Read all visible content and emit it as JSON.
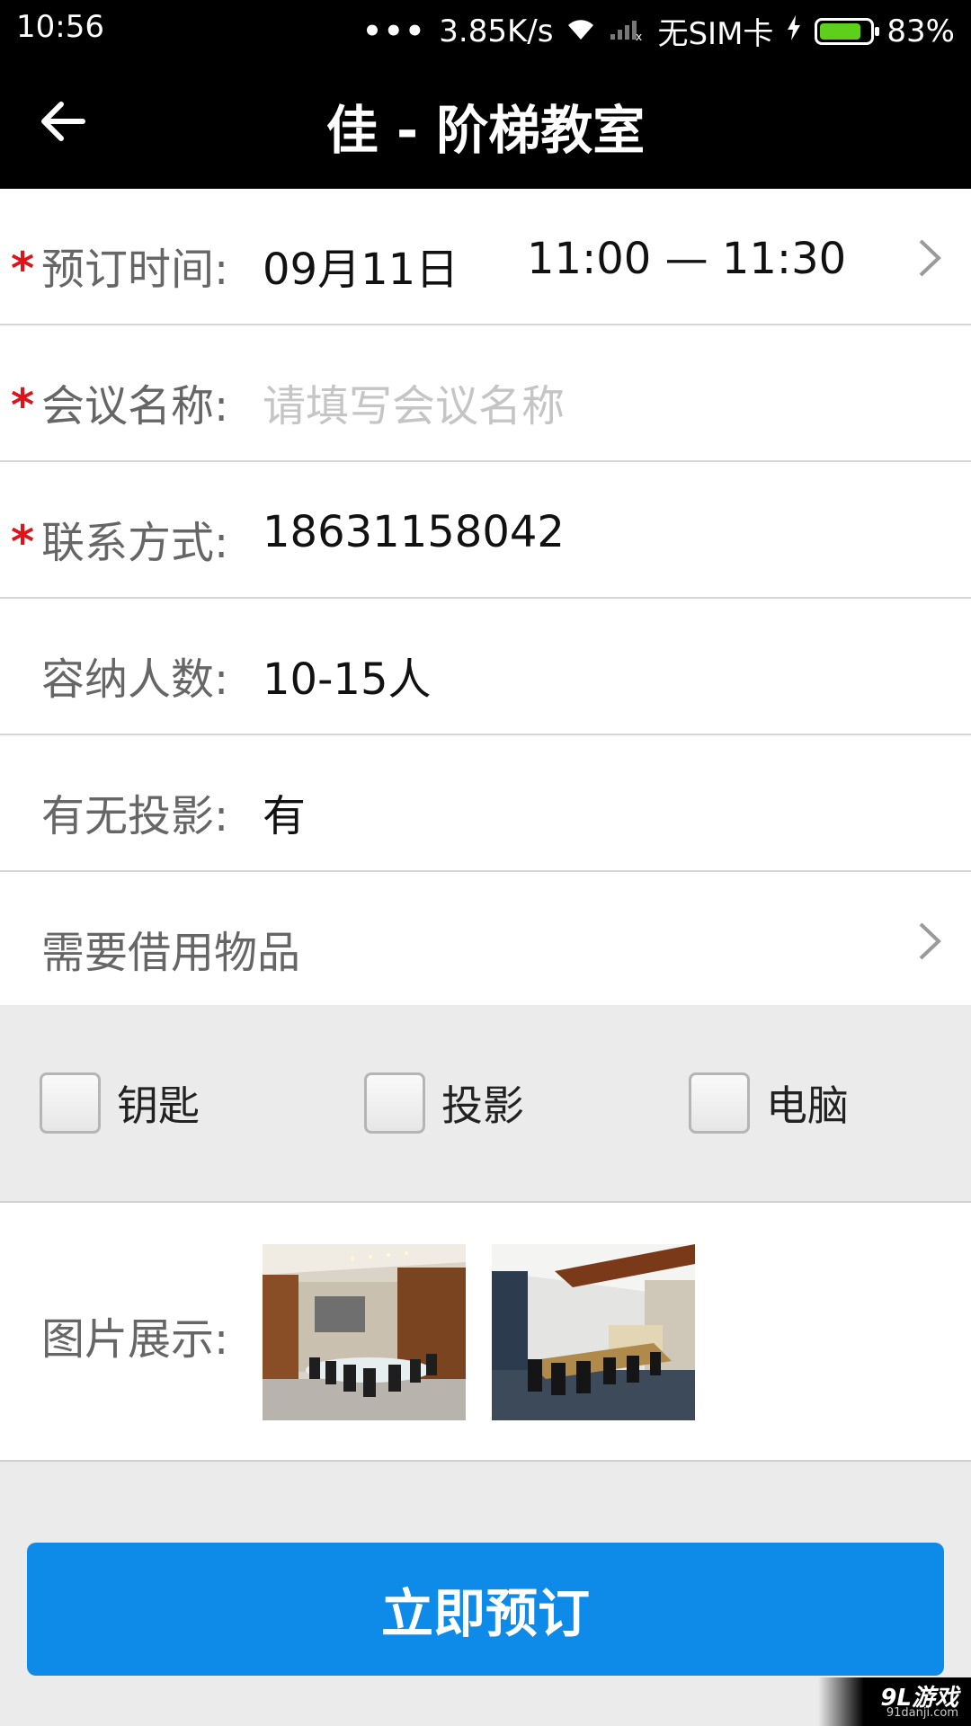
{
  "status_bar": {
    "time": "10:56",
    "dots": "•••",
    "speed": "3.85K/s",
    "carrier": "无SIM卡",
    "battery_percent": "83%",
    "battery_level": 0.83
  },
  "header": {
    "title": "佳 - 阶梯教室"
  },
  "form": {
    "booking_time": {
      "label": "预订时间:",
      "date": "09月11日",
      "time_range": "11:00 — 11:30"
    },
    "meeting_name": {
      "label": "会议名称:",
      "placeholder": "请填写会议名称"
    },
    "contact": {
      "label": "联系方式:",
      "value": "18631158042"
    },
    "capacity": {
      "label": "容纳人数:",
      "value": "10-15人"
    },
    "projector": {
      "label": "有无投影:",
      "value": "有"
    },
    "borrow_items": {
      "label": "需要借用物品"
    }
  },
  "required_mark": "*",
  "items": [
    {
      "label": "钥匙",
      "checked": false
    },
    {
      "label": "投影",
      "checked": false
    },
    {
      "label": "电脑",
      "checked": false
    }
  ],
  "images": {
    "label": "图片展示:"
  },
  "submit_label": "立即预订",
  "watermark": {
    "logo": "9L游戏",
    "site": "91danji.com"
  }
}
